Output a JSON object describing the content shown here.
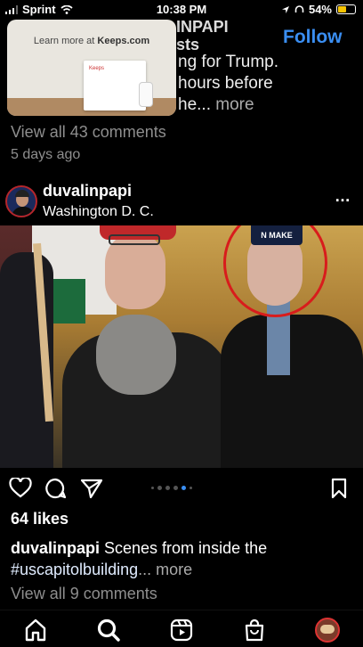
{
  "status_bar": {
    "carrier": "Sprint",
    "time": "10:38 PM",
    "battery": "54%",
    "battery_level": 0.54
  },
  "previous_post": {
    "username_fragment": "INPAPI",
    "subtitle_fragment": "sts",
    "follow_label": "Follow",
    "caption_lines": [
      "ng for Trump.",
      "hours before",
      "he..."
    ],
    "more_label": "more",
    "view_comments": "View all 43 comments",
    "timestamp": "5 days ago"
  },
  "ad": {
    "learn_more_prefix": "Learn more at",
    "learn_more_site": "Keeps.com",
    "product_brand": "Keeps"
  },
  "post": {
    "username": "duvalinpapi",
    "location": "Washington D. C.",
    "menu_label": "…",
    "image_hat_text": "N MAKE",
    "carousel_count": 6,
    "carousel_active": 4,
    "likes": "64 likes",
    "caption_user": "duvalinpapi",
    "caption_text": " Scenes from inside the",
    "caption_hashtag": "#uscapitolbuilding",
    "caption_more": "... more",
    "view_comments": "View all 9 comments"
  },
  "icons": {
    "like": "heart-icon",
    "comment": "comment-icon",
    "share": "send-icon",
    "save": "bookmark-icon",
    "home": "home-icon",
    "search": "search-icon",
    "reels": "reels-icon",
    "shop": "shop-icon",
    "profile": "profile-avatar"
  },
  "colors": {
    "accent": "#3a8ef2",
    "annotation_circle": "#d81c1c"
  }
}
